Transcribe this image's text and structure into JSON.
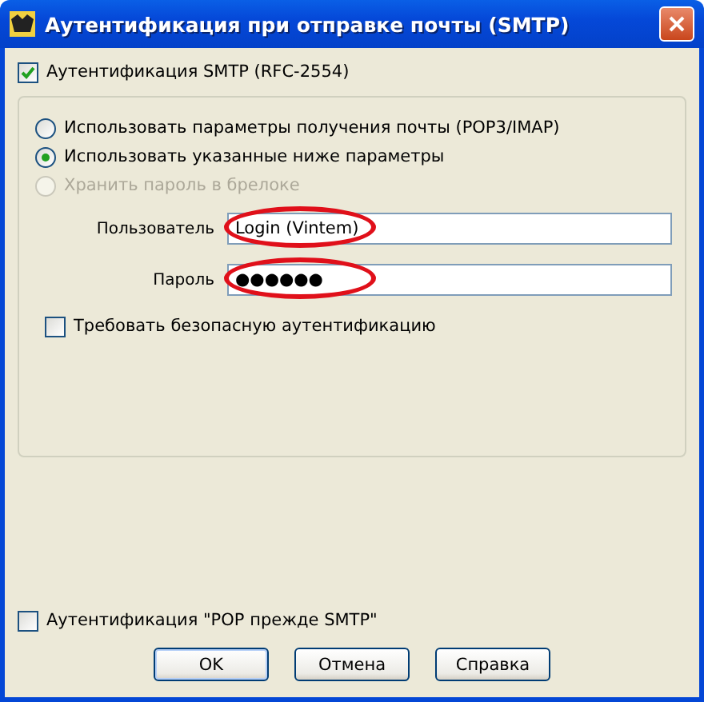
{
  "window": {
    "title": "Аутентификация при отправке почты (SMTP)"
  },
  "smtp_auth": {
    "label": "Аутентификация SMTP (RFC-2554)",
    "checked": true
  },
  "options": [
    {
      "label": "Использовать параметры получения почты (POP3/IMAP)",
      "selected": false,
      "disabled": false
    },
    {
      "label": "Использовать указанные ниже параметры",
      "selected": true,
      "disabled": false
    },
    {
      "label": "Хранить пароль в брелоке",
      "selected": false,
      "disabled": true
    }
  ],
  "fields": [
    {
      "label": "Пользователь",
      "value": "Login (Vintem)",
      "highlighted": true
    },
    {
      "label": "Пароль",
      "value": "●●●●●●",
      "highlighted": true
    }
  ],
  "secure_auth": {
    "label": "Требовать безопасную аутентификацию",
    "checked": false
  },
  "pop_before_smtp": {
    "label": "Аутентификация \"POP прежде SMTP\"",
    "checked": false
  },
  "buttons": [
    "OK",
    "Отмена",
    "Справка"
  ]
}
